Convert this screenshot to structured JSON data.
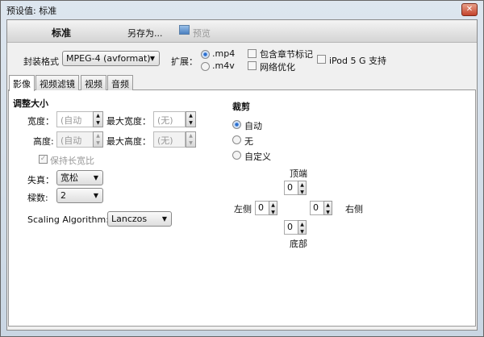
{
  "window": {
    "title": "预设值: 标准"
  },
  "toolbar": {
    "preset_name": "标准",
    "save_as": "另存为...",
    "preview": "预览"
  },
  "format": {
    "label": "封装格式",
    "value": "MPEG-4 (avformat)",
    "ext_label": "扩展：",
    "ext_options": [
      ".mp4",
      ".m4v"
    ],
    "ext_selected": ".mp4",
    "checkboxes": [
      {
        "label": "包含章节标记",
        "checked": false
      },
      {
        "label": "网络优化",
        "checked": false
      },
      {
        "label": "iPod 5 G 支持",
        "checked": false
      }
    ]
  },
  "tabs": [
    "影像",
    "视频滤镜",
    "视频",
    "音频"
  ],
  "resize": {
    "heading": "调整大小",
    "width_label": "宽度：",
    "width_value": "(自动",
    "max_width_label": "最大宽度：",
    "max_width_value": "(无)",
    "height_label": "高度:",
    "height_value": "(自动",
    "max_height_label": "最大高度：",
    "max_height_value": "(无)",
    "keep_aspect": "保持长宽比",
    "anamorphic_label": "失真：",
    "anamorphic_value": "宽松",
    "modulus_label": "樑数:",
    "modulus_value": "2",
    "scaling_label": "Scaling Algorithm:",
    "scaling_value": "Lanczos"
  },
  "crop": {
    "heading": "裁剪",
    "options": [
      "自动",
      "无",
      "自定义"
    ],
    "selected": "自动",
    "top_label": "顶端",
    "left_label": "左侧",
    "right_label": "右侧",
    "bottom_label": "底部",
    "top": "0",
    "left": "0",
    "right": "0",
    "bottom": "0"
  }
}
